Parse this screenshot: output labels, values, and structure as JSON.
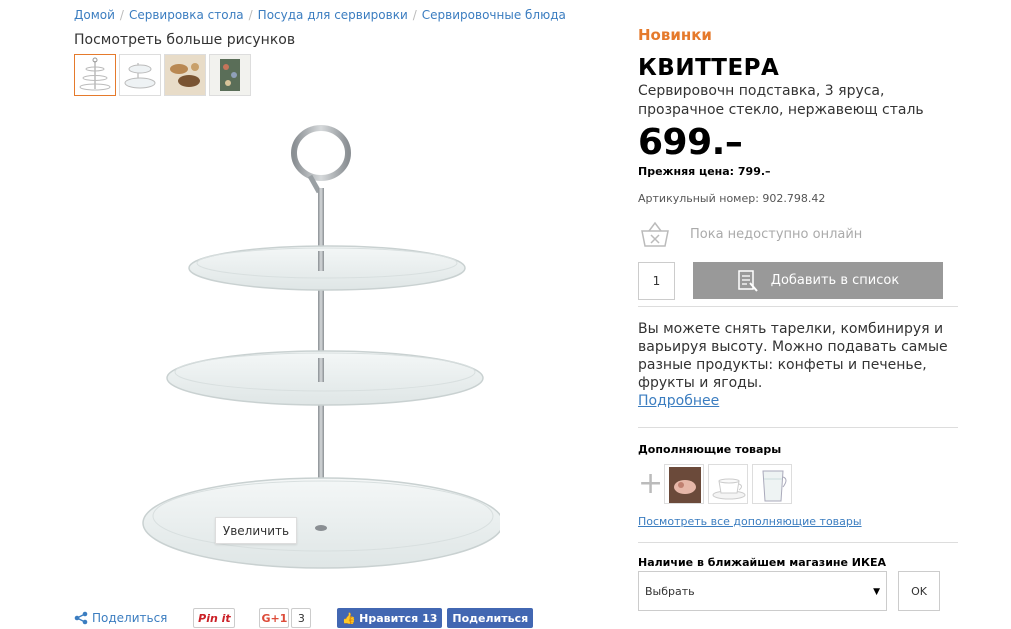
{
  "breadcrumb": [
    "Домой",
    "Сервировка стола",
    "Посуда для сервировки",
    "Сервировочные блюда"
  ],
  "gallery": {
    "more_label": "Посмотреть больше рисунков",
    "zoom_label": "Увеличить"
  },
  "share": {
    "share_label": "Поделиться",
    "pinit_label": "Pin it",
    "gplus_label": "G+1",
    "gplus_count": "3",
    "fb_like_label": "Нравится 13",
    "fb_share_label": "Поделиться"
  },
  "product": {
    "badge": "Новинки",
    "name": "КВИТТЕРА",
    "description": "Сервировочн подставка, 3 яруса, прозрачное стекло, нержавеющ сталь",
    "price": "699.–",
    "old_price": "Прежняя цена: 799.–",
    "article": "Артикульный номер: 902.798.42",
    "availability": "Пока недоступно онлайн",
    "quantity": "1",
    "add_button": "Добавить в список",
    "about": "Вы можете снять тарелки, комбинируя и варьируя высоту. Можно подавать самые разные продукты: конфеты и печенье, фрукты и ягоды.",
    "more_link": "Подробнее"
  },
  "complementary": {
    "title": "Дополняющие товары",
    "view_all": "Посмотреть все дополняющие товары"
  },
  "store": {
    "title": "Наличие в ближайшем магазине ИКЕА",
    "selected": "Выбрать",
    "ok_button": "OK"
  },
  "colors": {
    "accent": "#e57a2c",
    "link": "#3b7dc0",
    "button_gray": "#999999",
    "facebook": "#4267b2"
  }
}
